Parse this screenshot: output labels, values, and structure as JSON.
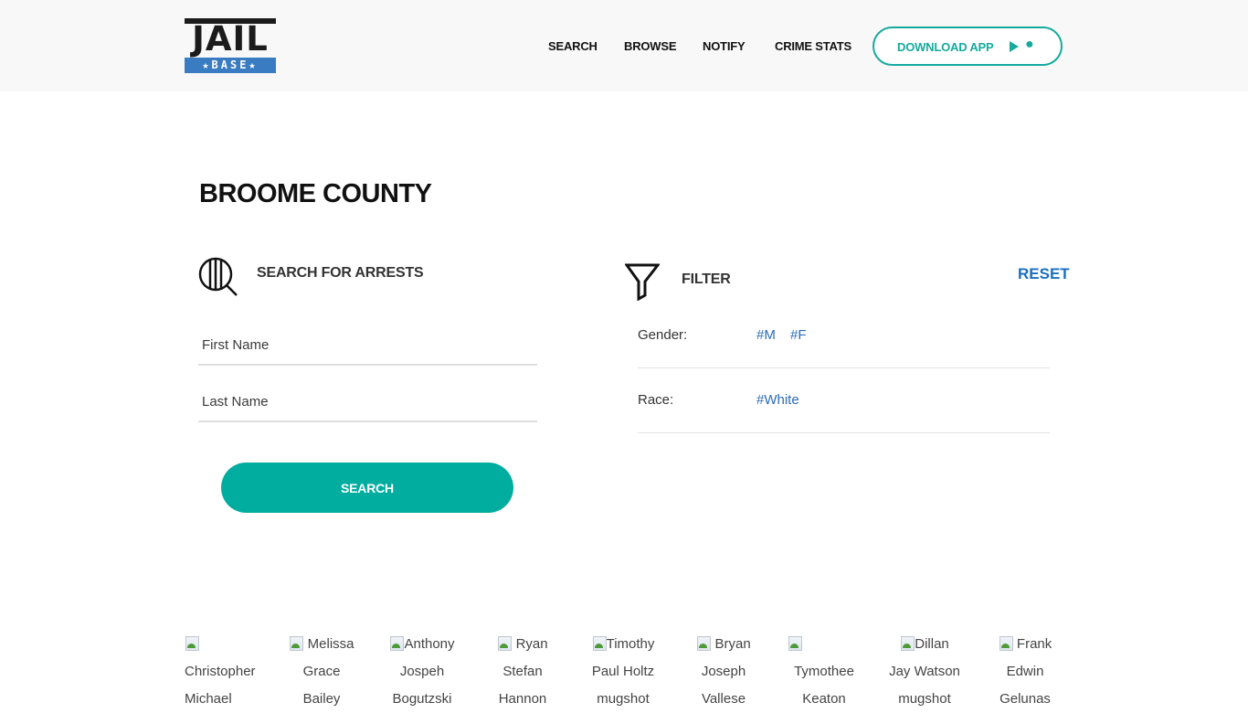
{
  "header": {
    "logo": {
      "top": "JAIL",
      "bottom": "★BASE★"
    },
    "nav": [
      "SEARCH",
      "BROWSE",
      "NOTIFY",
      "CRIME STATS"
    ],
    "download_label": "DOWNLOAD APP",
    "download_icons": [
      "play-store-icon",
      "apple-icon"
    ]
  },
  "page": {
    "title": "BROOME COUNTY"
  },
  "search": {
    "heading": "SEARCH FOR ARRESTS",
    "first_name_placeholder": "First Name",
    "last_name_placeholder": "Last Name",
    "button_label": "SEARCH"
  },
  "filter": {
    "heading": "FILTER",
    "reset_label": "RESET",
    "rows": [
      {
        "label": "Gender:",
        "tags": [
          "#M",
          "#F"
        ]
      },
      {
        "label": "Race:",
        "tags": [
          "#White"
        ]
      }
    ]
  },
  "mugshots": [
    {
      "alt": "Christopher Michael"
    },
    {
      "alt": "Melissa Grace Bailey"
    },
    {
      "alt": "Anthony Jospeh Bogutzski"
    },
    {
      "alt": "Ryan Stefan Hannon"
    },
    {
      "alt": "Timothy Paul Holtz mugshot"
    },
    {
      "alt": "Bryan Joseph Vallese"
    },
    {
      "alt": "Tymothee Keaton"
    },
    {
      "alt": "Dillan Jay Watson mugshot"
    },
    {
      "alt": "Frank Edwin Gelunas"
    }
  ],
  "colors": {
    "accent": "#00ad9f",
    "link": "#1a6fc1",
    "logo_blue": "#3a7cc2"
  }
}
